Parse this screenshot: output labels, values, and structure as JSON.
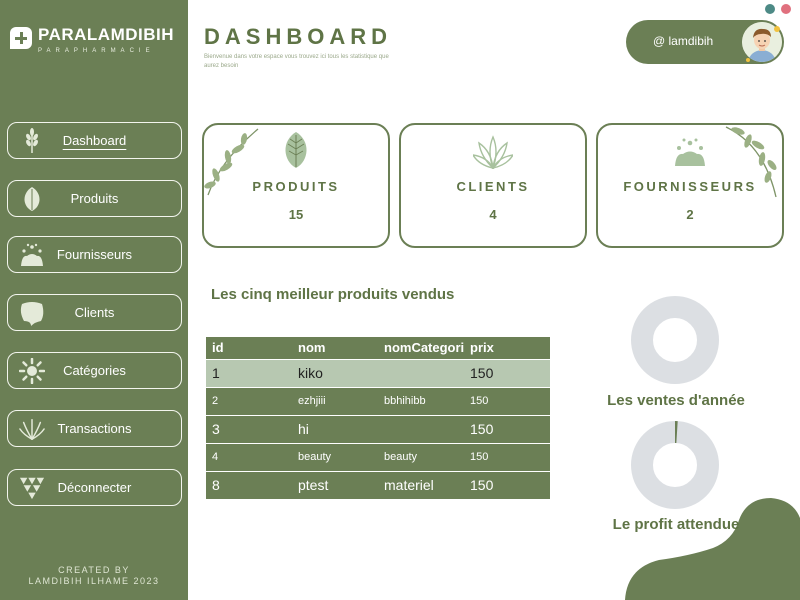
{
  "brand": {
    "name": "PARALAMDIBIH",
    "subtitle": "PARAPHARMACIE"
  },
  "nav": [
    {
      "label": "Dashboard",
      "icon": "wheat-icon",
      "active": true
    },
    {
      "label": "Produits",
      "icon": "leaf-icon",
      "active": false
    },
    {
      "label": "Fournisseurs",
      "icon": "splash-plant-icon",
      "active": false
    },
    {
      "label": "Clients",
      "icon": "blob-shape-icon",
      "active": false
    },
    {
      "label": "Catégories",
      "icon": "sun-flower-icon",
      "active": false
    },
    {
      "label": "Transactions",
      "icon": "fern-icon",
      "active": false
    },
    {
      "label": "Déconnecter",
      "icon": "triangles-icon",
      "active": false
    }
  ],
  "footer": {
    "line1": "CREATED BY",
    "line2": "LAMDIBIH ILHAME 2023"
  },
  "header": {
    "title": "DASHBOARD",
    "subtitle": "Bienvenue dans votre espace vous trouvez ici tous les statistique que aurez besoin"
  },
  "user": {
    "name": "@ lamdibih"
  },
  "colors": {
    "primary": "#6b7f55",
    "light_row": "#b7c8b1",
    "donut_track": "#dcdfe3",
    "dot_teal": "#4d8a86",
    "dot_pink": "#e0707e"
  },
  "cards": [
    {
      "title": "PRODUITS",
      "value": "15",
      "icon": "leaf-icon"
    },
    {
      "title": "CLIENTS",
      "value": "4",
      "icon": "fan-leaves-icon"
    },
    {
      "title": "FOURNISSEURS",
      "value": "2",
      "icon": "splash-plant-icon"
    }
  ],
  "top_products": {
    "title": "Les cinq meilleur produits vendus",
    "columns": [
      "id",
      "nom",
      "nomCategorie",
      "prix"
    ],
    "rows": [
      {
        "id": "1",
        "nom": "kiko",
        "categorie": "",
        "prix": "150"
      },
      {
        "id": "2",
        "nom": "ezhjiii",
        "categorie": "bbhihibb",
        "prix": "150"
      },
      {
        "id": "3",
        "nom": "hi",
        "categorie": "",
        "prix": "150"
      },
      {
        "id": "4",
        "nom": "beauty",
        "categorie": "beauty",
        "prix": "150"
      },
      {
        "id": "8",
        "nom": "ptest",
        "categorie": "materiel",
        "prix": "150"
      }
    ]
  },
  "charts": {
    "ventes": {
      "caption": "Les ventes d'année"
    },
    "profit": {
      "caption": "Le profit attendue"
    }
  },
  "chart_data": [
    {
      "type": "pie",
      "title": "Les ventes d'année",
      "values": [
        0
      ],
      "labels": []
    },
    {
      "type": "pie",
      "title": "Le profit attendue",
      "values": [
        0.01
      ],
      "labels": []
    }
  ]
}
